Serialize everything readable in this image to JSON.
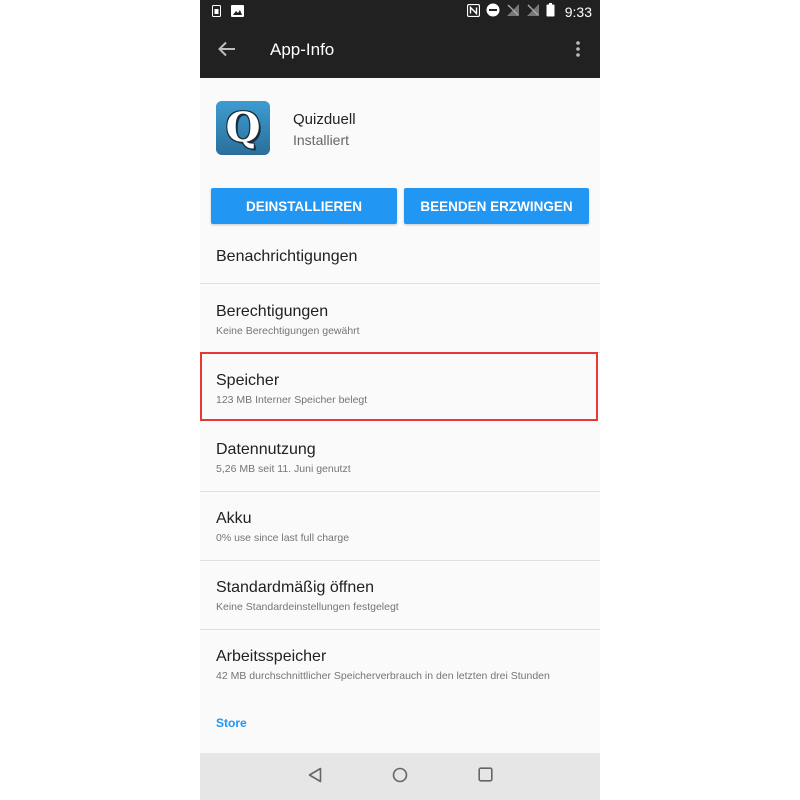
{
  "statusbar": {
    "time": "9:33"
  },
  "toolbar": {
    "title": "App-Info"
  },
  "app": {
    "name": "Quizduell",
    "status": "Installiert",
    "icon_letter": "Q"
  },
  "buttons": {
    "uninstall": "DEINSTALLIEREN",
    "force_stop": "BEENDEN ERZWINGEN"
  },
  "settings": {
    "notifications": {
      "title": "Benachrichtigungen"
    },
    "permissions": {
      "title": "Berechtigungen",
      "subtitle": "Keine Berechtigungen gewährt"
    },
    "storage": {
      "title": "Speicher",
      "subtitle": "123 MB Interner Speicher belegt"
    },
    "data_usage": {
      "title": "Datennutzung",
      "subtitle": "5,26 MB seit 11. Juni genutzt"
    },
    "battery": {
      "title": "Akku",
      "subtitle": "0% use since last full charge"
    },
    "open_by_default": {
      "title": "Standardmäßig öffnen",
      "subtitle": "Keine Standardeinstellungen festgelegt"
    },
    "memory": {
      "title": "Arbeitsspeicher",
      "subtitle": "42 MB durchschnittlicher Speicherverbrauch in den letzten drei Stunden"
    }
  },
  "store": {
    "label": "Store"
  },
  "colors": {
    "accent": "#2196f3",
    "toolbar": "#212121",
    "highlight": "#e53935"
  }
}
